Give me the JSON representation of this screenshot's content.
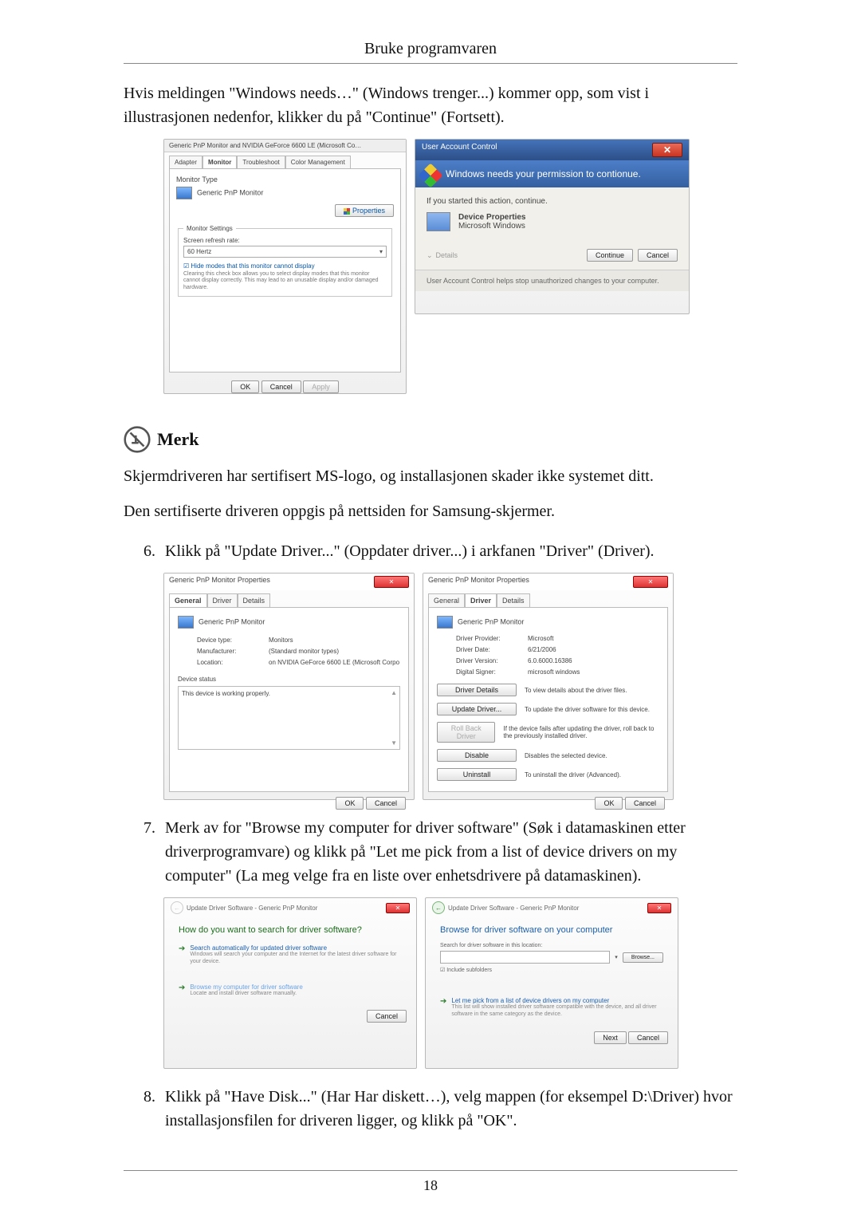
{
  "header": {
    "title": "Bruke programvaren"
  },
  "intro": "Hvis meldingen \"Windows needs…\" (Windows trenger...) kommer opp, som vist i illustrasjonen nedenfor, klikker du på \"Continue\" (Fortsett).",
  "shot1_left": {
    "title": "Generic PnP Monitor and NVIDIA GeForce 6600 LE (Microsoft Co…",
    "tabs": {
      "adapter": "Adapter",
      "monitor": "Monitor",
      "troubleshoot": "Troubleshoot",
      "color": "Color Management"
    },
    "monitor_type_label": "Monitor Type",
    "monitor_name": "Generic PnP Monitor",
    "properties_btn": "Properties",
    "settings_legend": "Monitor Settings",
    "refresh_label": "Screen refresh rate:",
    "refresh_value": "60 Hertz",
    "check_label": "Hide modes that this monitor cannot display",
    "check_note": "Clearing this check box allows you to select display modes that this monitor cannot display correctly. This may lead to an unusable display and/or damaged hardware.",
    "ok": "OK",
    "cancel": "Cancel",
    "apply": "Apply"
  },
  "shot1_right": {
    "title": "User Account Control",
    "band": "Windows needs your permission to contionue.",
    "started": "If you started this action, continue.",
    "prog_name": "Device Properties",
    "prog_pub": "Microsoft Windows",
    "details": "Details",
    "continue": "Continue",
    "cancel": "Cancel",
    "foot": "User Account Control helps stop unauthorized changes to your computer."
  },
  "note_heading": "Merk",
  "note_p1": "Skjermdriveren har sertifisert MS-logo, og installasjonen skader ikke systemet ditt.",
  "note_p2": "Den sertifiserte driveren oppgis på nettsiden for Samsung-skjermer.",
  "step6_num": "6.",
  "step6_text": "Klikk på \"Update Driver...\" (Oppdater driver...) i arkfanen \"Driver\" (Driver).",
  "shot2_left": {
    "title": "Generic PnP Monitor Properties",
    "tabs": {
      "general": "General",
      "driver": "Driver",
      "details": "Details"
    },
    "name": "Generic PnP Monitor",
    "rows": {
      "type_k": "Device type:",
      "type_v": "Monitors",
      "mfr_k": "Manufacturer:",
      "mfr_v": "(Standard monitor types)",
      "loc_k": "Location:",
      "loc_v": "on NVIDIA GeForce 6600 LE (Microsoft Corpo"
    },
    "status_label": "Device status",
    "status_text": "This device is working properly.",
    "ok": "OK",
    "cancel": "Cancel"
  },
  "shot2_right": {
    "title": "Generic PnP Monitor Properties",
    "tabs": {
      "general": "General",
      "driver": "Driver",
      "details": "Details"
    },
    "name": "Generic PnP Monitor",
    "rows": {
      "prov_k": "Driver Provider:",
      "prov_v": "Microsoft",
      "date_k": "Driver Date:",
      "date_v": "6/21/2006",
      "ver_k": "Driver Version:",
      "ver_v": "6.0.6000.16386",
      "sig_k": "Digital Signer:",
      "sig_v": "microsoft windows"
    },
    "btns": {
      "details": "Driver Details",
      "details_d": "To view details about the driver files.",
      "update": "Update Driver...",
      "update_d": "To update the driver software for this device.",
      "roll": "Roll Back Driver",
      "roll_d": "If the device fails after updating the driver, roll back to the previously installed driver.",
      "disable": "Disable",
      "disable_d": "Disables the selected device.",
      "uninstall": "Uninstall",
      "uninstall_d": "To uninstall the driver (Advanced)."
    },
    "ok": "OK",
    "cancel": "Cancel"
  },
  "step7_num": "7.",
  "step7_text": "Merk av for \"Browse my computer for driver software\" (Søk i datamaskinen etter driverprogramvare) og klikk på \"Let me pick from a list of device drivers on my computer\" (La meg velge fra en liste over enhetsdrivere på datamaskinen).",
  "shot3_left": {
    "title": "Update Driver Software - Generic PnP Monitor",
    "heading": "How do you want to search for driver software?",
    "opt1": "Search automatically for updated driver software",
    "opt1_sub": "Windows will search your computer and the Internet for the latest driver software for your device.",
    "opt2": "Browse my computer for driver software",
    "opt2_sub": "Locate and install driver software manually.",
    "cancel": "Cancel"
  },
  "shot3_right": {
    "title": "Update Driver Software - Generic PnP Monitor",
    "heading": "Browse for driver software on your computer",
    "search_label": "Search for driver software in this location:",
    "browse": "Browse...",
    "include": "Include subfolders",
    "opt": "Let me pick from a list of device drivers on my computer",
    "opt_sub": "This list will show installed driver software compatible with the device, and all driver software in the same category as the device.",
    "next": "Next",
    "cancel": "Cancel"
  },
  "step8_num": "8.",
  "step8_text": "Klikk på \"Have Disk...\" (Har Har diskett…), velg mappen (for eksempel D:\\Driver) hvor installasjonsfilen for driveren ligger, og klikk på \"OK\".",
  "page_number": "18"
}
